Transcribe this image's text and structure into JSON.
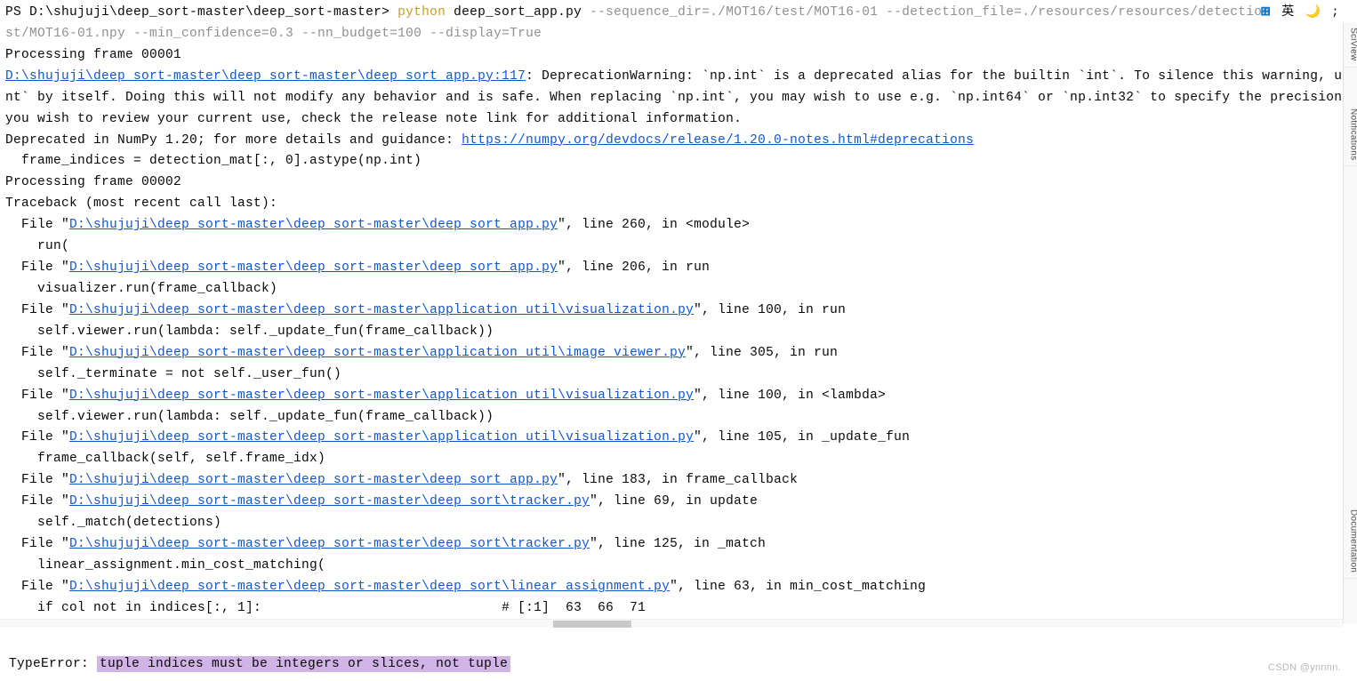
{
  "prompt": {
    "ps": "PS D:\\shujuji\\deep_sort-master\\deep_sort-master>",
    "python": "python",
    "script": "deep_sort_app.py",
    "args_line1": "--sequence_dir=./MOT16/test/MOT16-01 --detection_file=./resources/resources/detection",
    "args_line2": "st/MOT16-01.npy --min_confidence=0.3 --nn_budget=100 --display=True"
  },
  "output": {
    "processing1": "Processing frame 00001",
    "warn_file": "D:\\shujuji\\deep_sort-master\\deep_sort-master\\deep_sort_app.py:117",
    "warn_text1": ": DeprecationWarning: `np.int` is a deprecated alias for the builtin `int`. To silence this warning, use `i",
    "warn_text2": "nt` by itself. Doing this will not modify any behavior and is safe. When replacing `np.int`, you may wish to use e.g. `np.int64` or `np.int32` to specify the precision. If",
    "warn_text3": "you wish to review your current use, check the release note link for additional information.",
    "deprecated_prefix": "Deprecated in NumPy 1.20; for more details and guidance: ",
    "deprecated_url": "https://numpy.org/devdocs/release/1.20.0-notes.html#deprecations",
    "frame_indices": "  frame_indices = detection_mat[:, 0].astype(np.int)",
    "processing2": "Processing frame 00002",
    "traceback_header": "Traceback (most recent call last):"
  },
  "traceback": [
    {
      "prefix": "  File \"",
      "path": "D:\\shujuji\\deep_sort-master\\deep_sort-master\\deep_sort_app.py",
      "suffix": "\", line 260, in <module>",
      "code": "    run("
    },
    {
      "prefix": "  File \"",
      "path": "D:\\shujuji\\deep_sort-master\\deep_sort-master\\deep_sort_app.py",
      "suffix": "\", line 206, in run",
      "code": "    visualizer.run(frame_callback)"
    },
    {
      "prefix": "  File \"",
      "path": "D:\\shujuji\\deep_sort-master\\deep_sort-master\\application_util\\visualization.py",
      "suffix": "\", line 100, in run",
      "code": "    self.viewer.run(lambda: self._update_fun(frame_callback))"
    },
    {
      "prefix": "  File \"",
      "path": "D:\\shujuji\\deep_sort-master\\deep_sort-master\\application_util\\image_viewer.py",
      "suffix": "\", line 305, in run",
      "code": "    self._terminate = not self._user_fun()"
    },
    {
      "prefix": "  File \"",
      "path": "D:\\shujuji\\deep_sort-master\\deep_sort-master\\application_util\\visualization.py",
      "suffix": "\", line 100, in <lambda>",
      "code": "    self.viewer.run(lambda: self._update_fun(frame_callback))"
    },
    {
      "prefix": "  File \"",
      "path": "D:\\shujuji\\deep_sort-master\\deep_sort-master\\application_util\\visualization.py",
      "suffix": "\", line 105, in _update_fun",
      "code": "    frame_callback(self, self.frame_idx)"
    },
    {
      "prefix": "  File \"",
      "path": "D:\\shujuji\\deep_sort-master\\deep_sort-master\\deep_sort_app.py",
      "suffix": "\", line 183, in frame_callback",
      "code": null
    },
    {
      "prefix": "  File \"",
      "path": "D:\\shujuji\\deep_sort-master\\deep_sort-master\\deep_sort\\tracker.py",
      "suffix": "\", line 69, in update",
      "code": "    self._match(detections)"
    },
    {
      "prefix": "  File \"",
      "path": "D:\\shujuji\\deep_sort-master\\deep_sort-master\\deep_sort\\tracker.py",
      "suffix": "\", line 125, in _match",
      "code": "    linear_assignment.min_cost_matching("
    },
    {
      "prefix": "  File \"",
      "path": "D:\\shujuji\\deep_sort-master\\deep_sort-master\\deep_sort\\linear_assignment.py",
      "suffix": "\", line 63, in min_cost_matching",
      "code": "    if col not in indices[:, 1]:                              # [:1]  63  66  71"
    }
  ],
  "error": {
    "label": "TypeError: ",
    "message": "tuple indices must be integers or slices, not tuple"
  },
  "sidebar": {
    "sciview": "SciView",
    "notifications": "Notifications",
    "documentation": "Documentation"
  },
  "watermark": "CSDN @ynnnn.",
  "toolbar": {
    "lang": "英"
  }
}
